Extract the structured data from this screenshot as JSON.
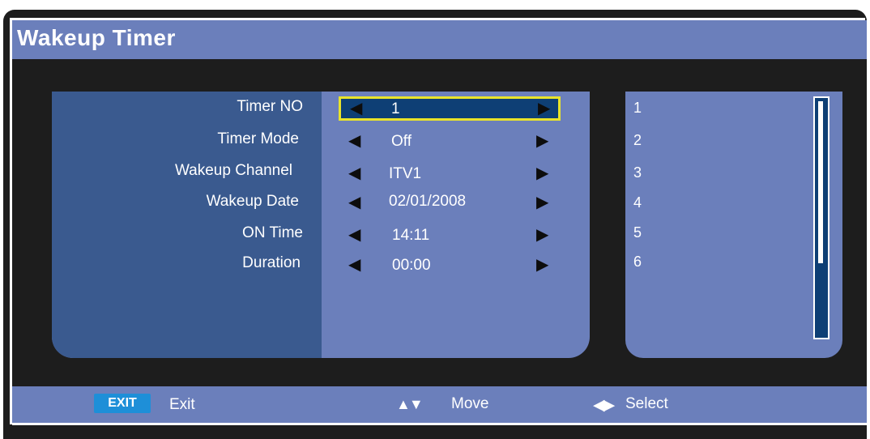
{
  "title": "Wakeup Timer",
  "rows": [
    {
      "label": "Timer NO",
      "value": "1"
    },
    {
      "label": "Timer Mode",
      "value": "Off"
    },
    {
      "label": "Wakeup Channel",
      "value": "ITV1"
    },
    {
      "label": "Wakeup Date",
      "value": "02/01/2008"
    },
    {
      "label": "ON Time",
      "value": "14:11"
    },
    {
      "label": "Duration",
      "value": "00:00"
    }
  ],
  "selected_row": 0,
  "timer_list": [
    "1",
    "2",
    "3",
    "4",
    "5",
    "6"
  ],
  "footer": {
    "exit_badge": "EXIT",
    "exit_label": "Exit",
    "move_icon": "▲▼",
    "move_label": "Move",
    "select_icon": "◀▶",
    "select_label": "Select"
  },
  "icons": {
    "left_arrow": "◀",
    "right_arrow": "▶"
  },
  "colors": {
    "panel": "#6b7fbb",
    "label_panel": "#3a5a8f",
    "highlight": "#0e3f75",
    "highlight_border": "#e9e32a",
    "exit_badge": "#1e8fd8"
  }
}
